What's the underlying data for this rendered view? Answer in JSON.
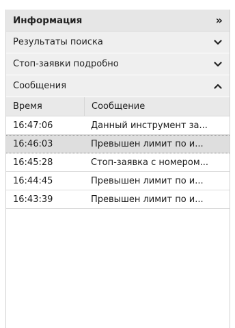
{
  "header": {
    "title": "Информация",
    "collapse_icon": "»"
  },
  "sections": [
    {
      "label": "Результаты поиска",
      "state": "collapsed"
    },
    {
      "label": "Стоп-заявки подробно",
      "state": "collapsed"
    },
    {
      "label": "Сообщения",
      "state": "expanded"
    }
  ],
  "messages": {
    "columns": [
      "Время",
      "Сообщение"
    ],
    "rows": [
      {
        "time": "16:47:06",
        "text": "Данный инструмент за...",
        "selected": false
      },
      {
        "time": "16:46:03",
        "text": "Превышен лимит по и...",
        "selected": true
      },
      {
        "time": "16:45:28",
        "text": "Стоп-заявка с номером...",
        "selected": false
      },
      {
        "time": "16:44:45",
        "text": "Превышен лимит по и...",
        "selected": false
      },
      {
        "time": "16:43:39",
        "text": "Превышен лимит по и...",
        "selected": false
      }
    ]
  }
}
